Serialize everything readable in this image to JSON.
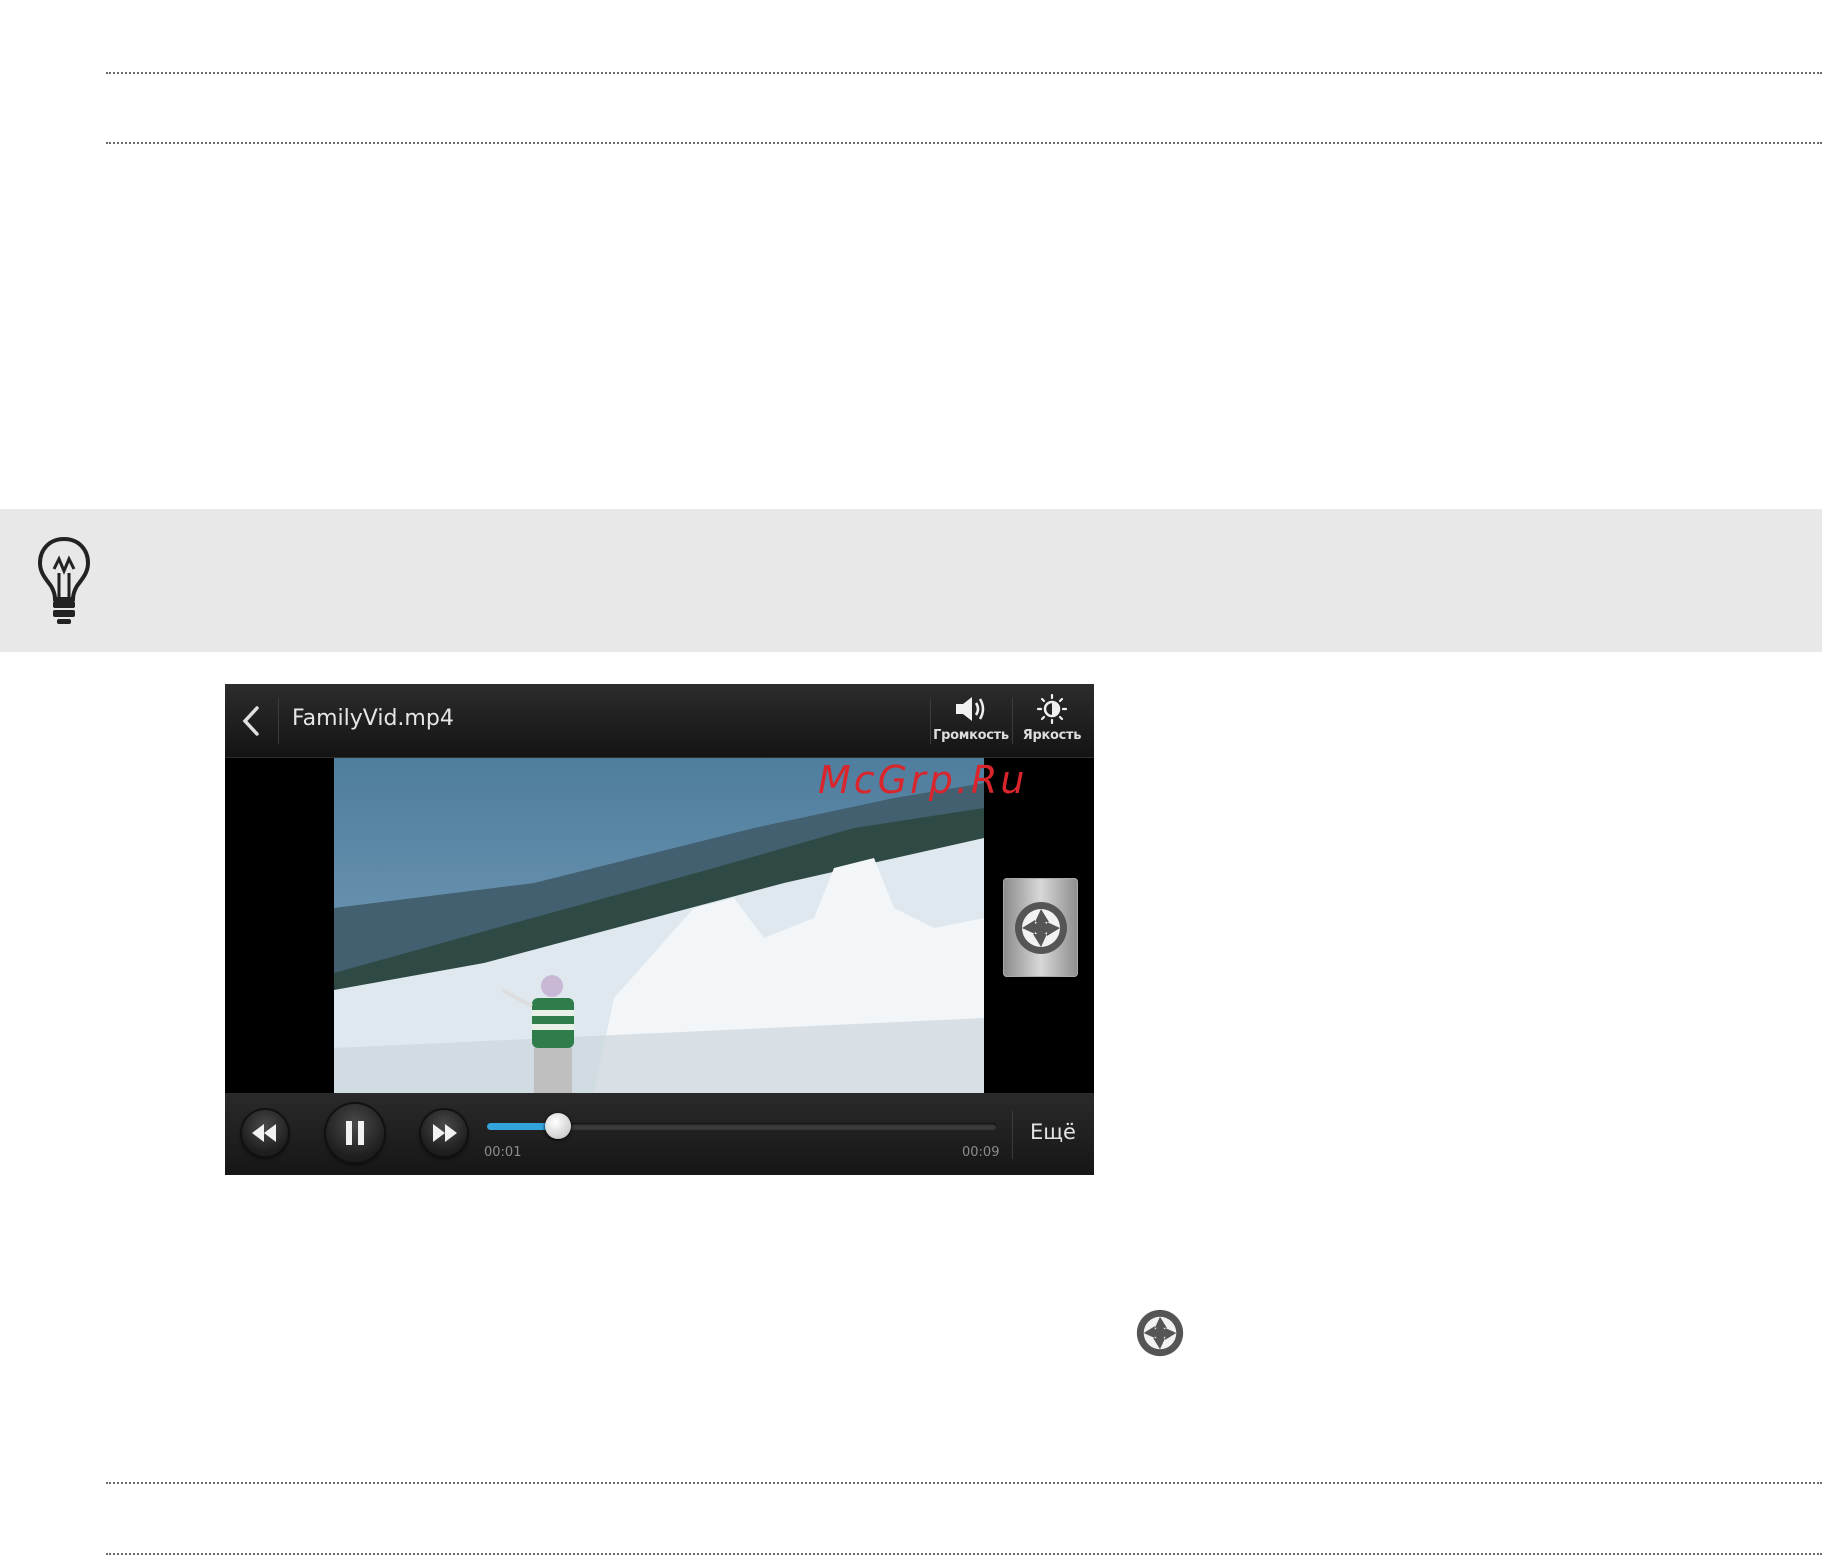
{
  "player": {
    "file_name": "FamilyVid.mp4",
    "volume_label": "Громкость",
    "brightness_label": "Яркость",
    "elapsed": "00:01",
    "duration": "00:09",
    "progress_fraction": 0.14,
    "more_label": "Ещё",
    "accent_color": "#33a3dc"
  },
  "watermark": "McGrp.Ru",
  "icons": {
    "tip": "lightbulb-icon",
    "back": "back-arrow-icon",
    "volume": "speaker-icon",
    "brightness": "sun-icon",
    "capture": "camera-shutter-icon",
    "rewind": "rewind-icon",
    "pause": "pause-icon",
    "forward": "fast-forward-icon"
  }
}
